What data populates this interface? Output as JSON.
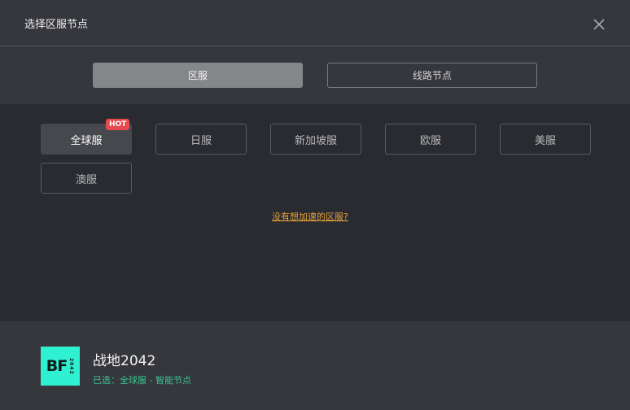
{
  "header": {
    "title": "选择区服节点"
  },
  "tabs": [
    {
      "label": "区服",
      "active": true
    },
    {
      "label": "线路节点",
      "active": false
    }
  ],
  "regions": {
    "items": [
      {
        "label": "全球服",
        "selected": true,
        "badge": "HOT"
      },
      {
        "label": "日服",
        "selected": false
      },
      {
        "label": "新加坡服",
        "selected": false
      },
      {
        "label": "欧服",
        "selected": false
      },
      {
        "label": "美服",
        "selected": false
      },
      {
        "label": "澳服",
        "selected": false
      }
    ],
    "help_link": "没有想加速的区服?"
  },
  "footer": {
    "logo_letters": "BF",
    "logo_year": "2042",
    "game_name": "战地2042",
    "selection": "已选：全球服 - 智能节点"
  },
  "colors": {
    "logo_bg": "#2ff0d0",
    "badge_bg": "#e8484f",
    "link": "#e5a23a",
    "selection_text": "#39c48f"
  }
}
